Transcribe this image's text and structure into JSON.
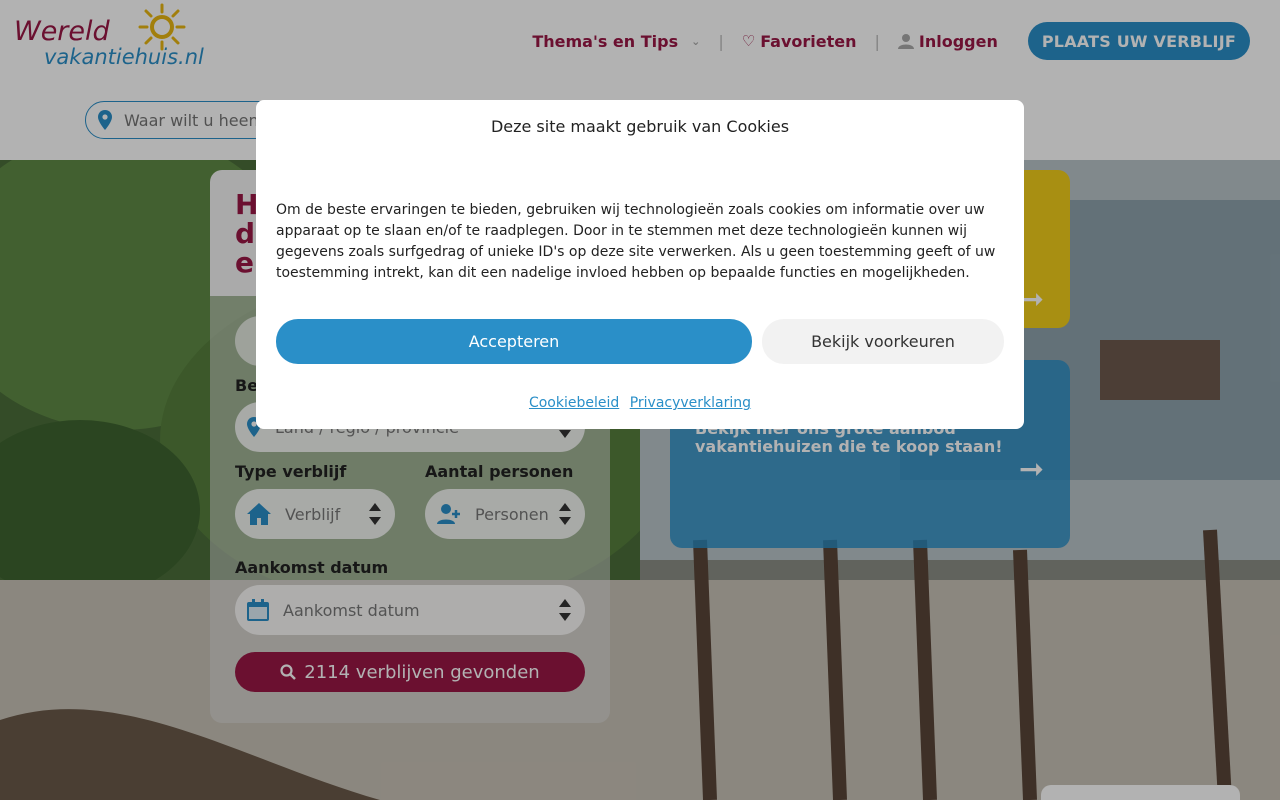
{
  "brand": {
    "logo_line1": "Wereld",
    "logo_line2": "vakantiehuis.nl"
  },
  "nav": {
    "themes_label": "Thema's en Tips",
    "favorites_label": "Favorieten",
    "login_label": "Inloggen",
    "place_button": "PLAATS UW VERBLIJF"
  },
  "search": {
    "placeholder": "Waar wilt u heen?"
  },
  "panel": {
    "title_l1": "H",
    "title_l2": "d",
    "title_l3": "ei",
    "destination_label": "Be",
    "destination_placeholder": "Land / regio / provincie",
    "type_label": "Type verblijf",
    "type_placeholder": "Verblijf",
    "persons_label": "Aantal personen",
    "persons_placeholder": "Personen",
    "arrival_label": "Aankomst datum",
    "arrival_placeholder": "Aankomst datum",
    "search_button": "2114 verblijven gevonden"
  },
  "promo": {
    "blue_text": "Bekijk hier ons grote aanbod vakantiehuizen die te koop staan!"
  },
  "cookie": {
    "title": "Deze site maakt gebruik van Cookies",
    "body": "Om de beste ervaringen te bieden, gebruiken wij technologieën zoals cookies om informatie over uw apparaat op te slaan en/of te raadplegen. Door in te stemmen met deze technologieën kunnen wij gegevens zoals surfgedrag of unieke ID's op deze site verwerken. Als u geen toestemming geeft of uw toestemming intrekt, kan dit een nadelige invloed hebben op bepaalde functies en mogelijkheden.",
    "accept_button": "Accepteren",
    "prefs_button": "Bekijk voorkeuren",
    "cookie_policy_link": "Cookiebeleid",
    "privacy_link": "Privacyverklaring"
  },
  "colors": {
    "brand": "#9a1746",
    "accent": "#2a8fc8",
    "yellow": "#f1cd1b"
  }
}
